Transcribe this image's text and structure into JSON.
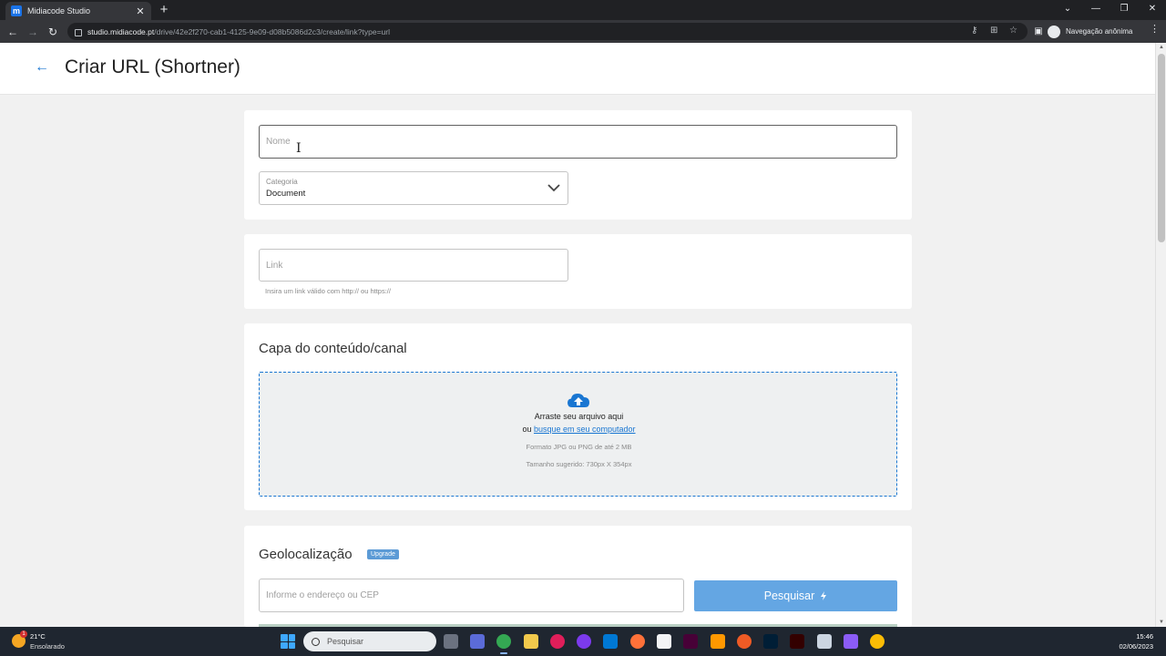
{
  "browser": {
    "tab_title": "Midiacode Studio",
    "tab_favicon_letter": "m",
    "tab_close": "✕",
    "new_tab": "+",
    "window_controls": [
      "⌄",
      "—",
      "❐",
      "✕"
    ],
    "url_host": "studio.midiacode.pt",
    "url_path": "/drive/42e2f270-cab1-4125-9e09-d08b5086d2c3/create/link?type=url",
    "incognito_label": "Navegação anônima"
  },
  "header": {
    "back_icon": "←",
    "title": "Criar URL (Shortner)"
  },
  "form": {
    "name_placeholder": "Nome",
    "category_label": "Categoria",
    "category_value": "Document",
    "link_placeholder": "Link",
    "link_helper": "Insira um link válido com http:// ou https://"
  },
  "cover": {
    "title": "Capa do conteúdo/canal",
    "drop_text": "Arraste seu arquivo aqui",
    "or_text": "ou ",
    "browse_link": "busque em seu computador",
    "format_text": "Formato JPG ou PNG de até 2 MB",
    "size_text": "Tamanho sugerido: 730px X 354px"
  },
  "geo": {
    "title": "Geolocalização",
    "badge": "Upgrade",
    "address_placeholder": "Informe o endereço ou CEP",
    "search_button": "Pesquisar"
  },
  "taskbar": {
    "weather_temp": "21°C",
    "weather_desc": "Ensolarado",
    "weather_badge": "1",
    "search_text": "Pesquisar",
    "time": "15:46",
    "date": "02/06/2023"
  },
  "colors": {
    "accent": "#1976d2",
    "search_button": "#64a6e3",
    "badge": "#5c9bd6"
  }
}
